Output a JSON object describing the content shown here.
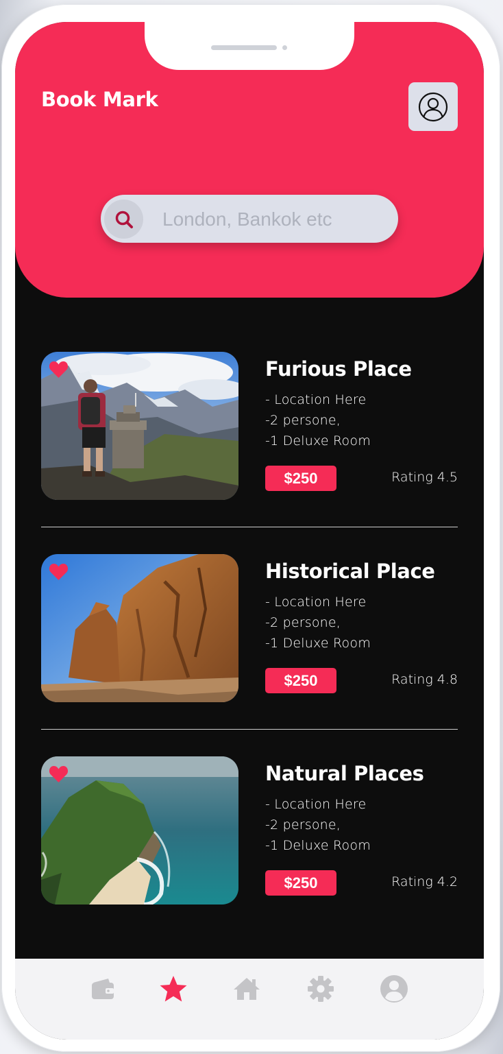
{
  "header": {
    "title": "Book Mark",
    "profile_icon": "user-circle-icon"
  },
  "search": {
    "icon": "search-icon",
    "placeholder": "London, Bankok etc"
  },
  "colors": {
    "accent": "#f52c56",
    "background": "#0d0d0d",
    "nav_inactive": "#c4c4c7"
  },
  "places": [
    {
      "title": "Furious Place",
      "location": "- Location Here",
      "persons": "-2 persone,",
      "room": "-1 Deluxe Room",
      "price": "$250",
      "rating": "Rating 4.5",
      "favorite": true
    },
    {
      "title": "Historical Place",
      "location": "- Location Here",
      "persons": "-2 persone,",
      "room": "-1 Deluxe Room",
      "price": "$250",
      "rating": "Rating 4.8",
      "favorite": true
    },
    {
      "title": "Natural Places",
      "location": "- Location Here",
      "persons": "-2 persone,",
      "room": "-1 Deluxe Room",
      "price": "$250",
      "rating": "Rating 4.2",
      "favorite": true
    }
  ],
  "bottom_nav": {
    "items": [
      {
        "icon": "wallet-icon",
        "active": false
      },
      {
        "icon": "star-icon",
        "active": true
      },
      {
        "icon": "home-icon",
        "active": false
      },
      {
        "icon": "gear-icon",
        "active": false
      },
      {
        "icon": "user-circle-icon",
        "active": false
      }
    ]
  }
}
